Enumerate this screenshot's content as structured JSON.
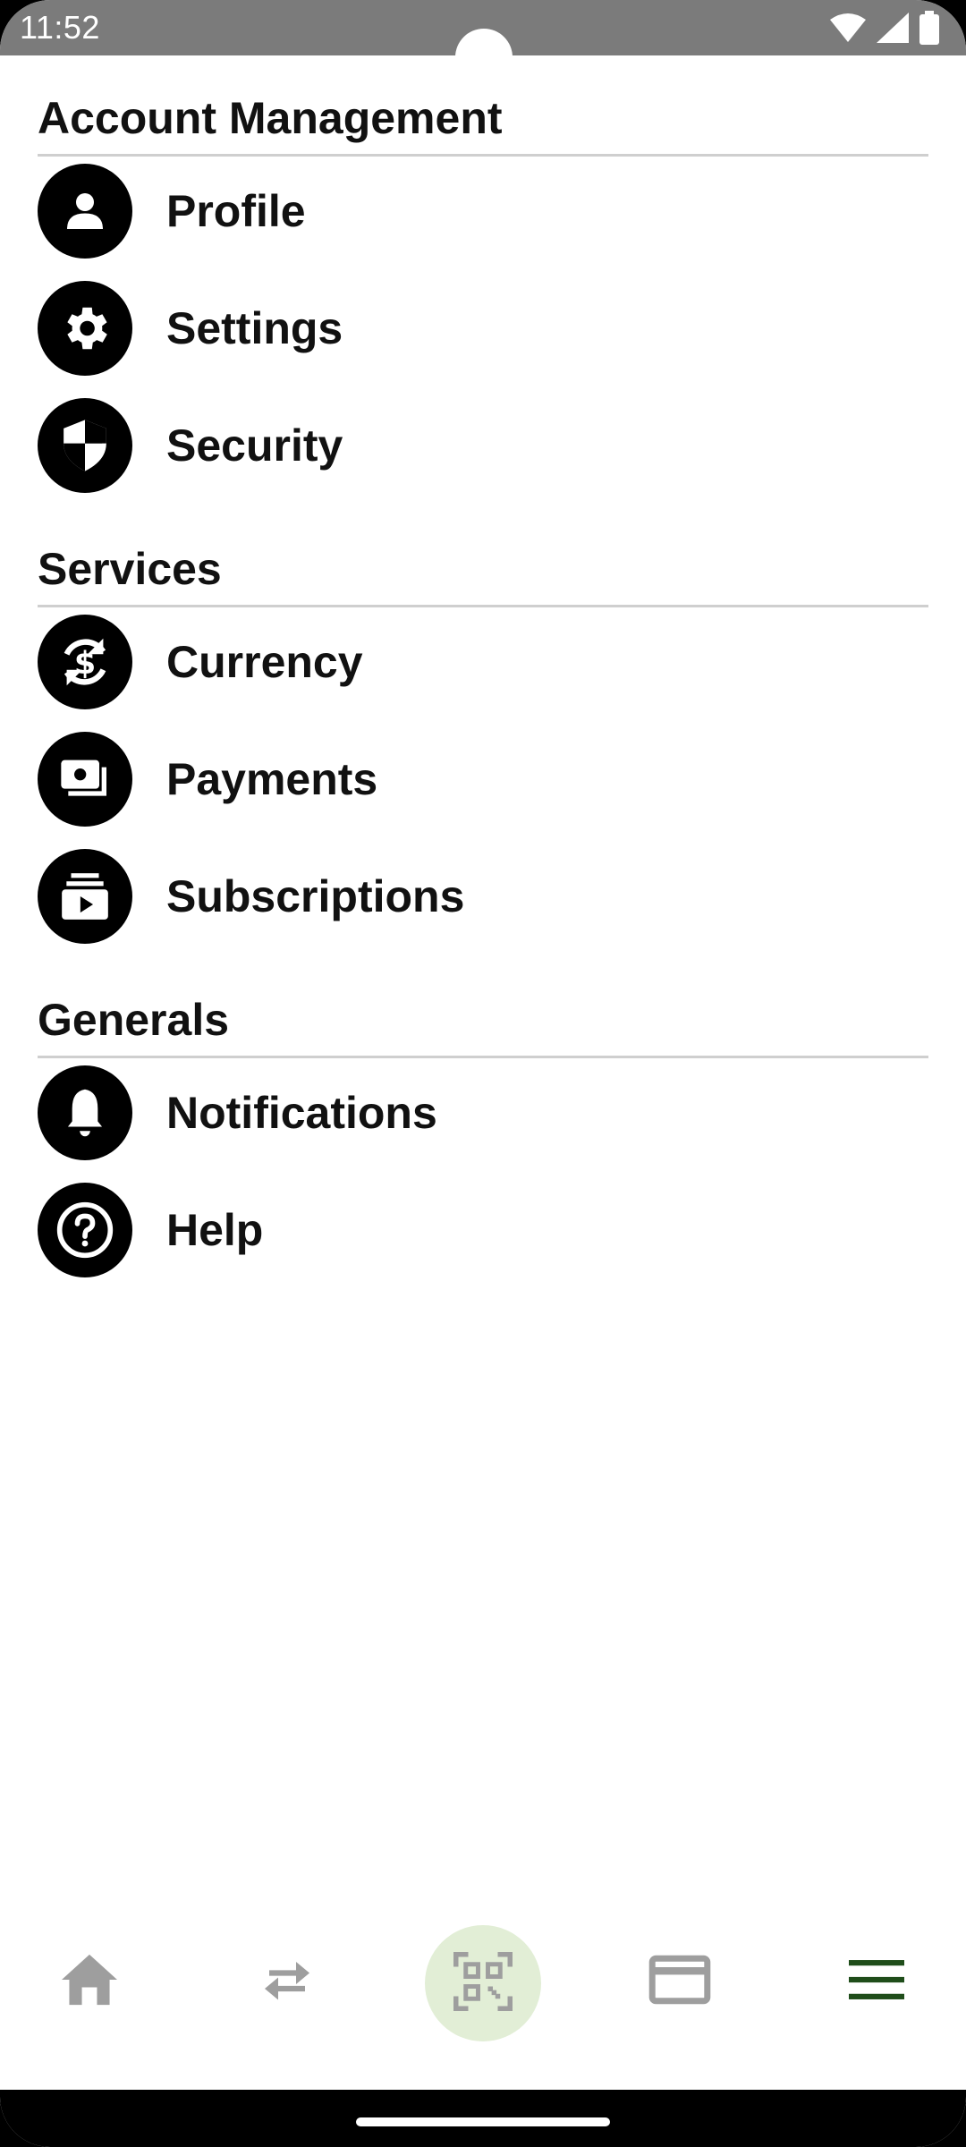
{
  "status_bar": {
    "time": "11:52",
    "icons": [
      "wifi-icon",
      "signal-icon",
      "battery-icon"
    ]
  },
  "sections": [
    {
      "title": "Account Management",
      "items": [
        {
          "label": "Profile",
          "icon": "person-icon"
        },
        {
          "label": "Settings",
          "icon": "gear-icon"
        },
        {
          "label": "Security",
          "icon": "shield-icon"
        }
      ]
    },
    {
      "title": "Services",
      "items": [
        {
          "label": "Currency",
          "icon": "currency-exchange-icon"
        },
        {
          "label": "Payments",
          "icon": "payments-icon"
        },
        {
          "label": "Subscriptions",
          "icon": "subscriptions-icon"
        }
      ]
    },
    {
      "title": "Generals",
      "items": [
        {
          "label": "Notifications",
          "icon": "bell-icon"
        },
        {
          "label": "Help",
          "icon": "help-icon"
        }
      ]
    }
  ],
  "bottom_nav": {
    "items": [
      "home-icon",
      "transfer-icon",
      "qr-code-icon",
      "card-icon",
      "menu-icon"
    ],
    "active": "menu-icon",
    "colors": {
      "inactive": "#9e9e9e",
      "active": "#1f4d1a",
      "qr_background": "#e2eed6"
    }
  }
}
